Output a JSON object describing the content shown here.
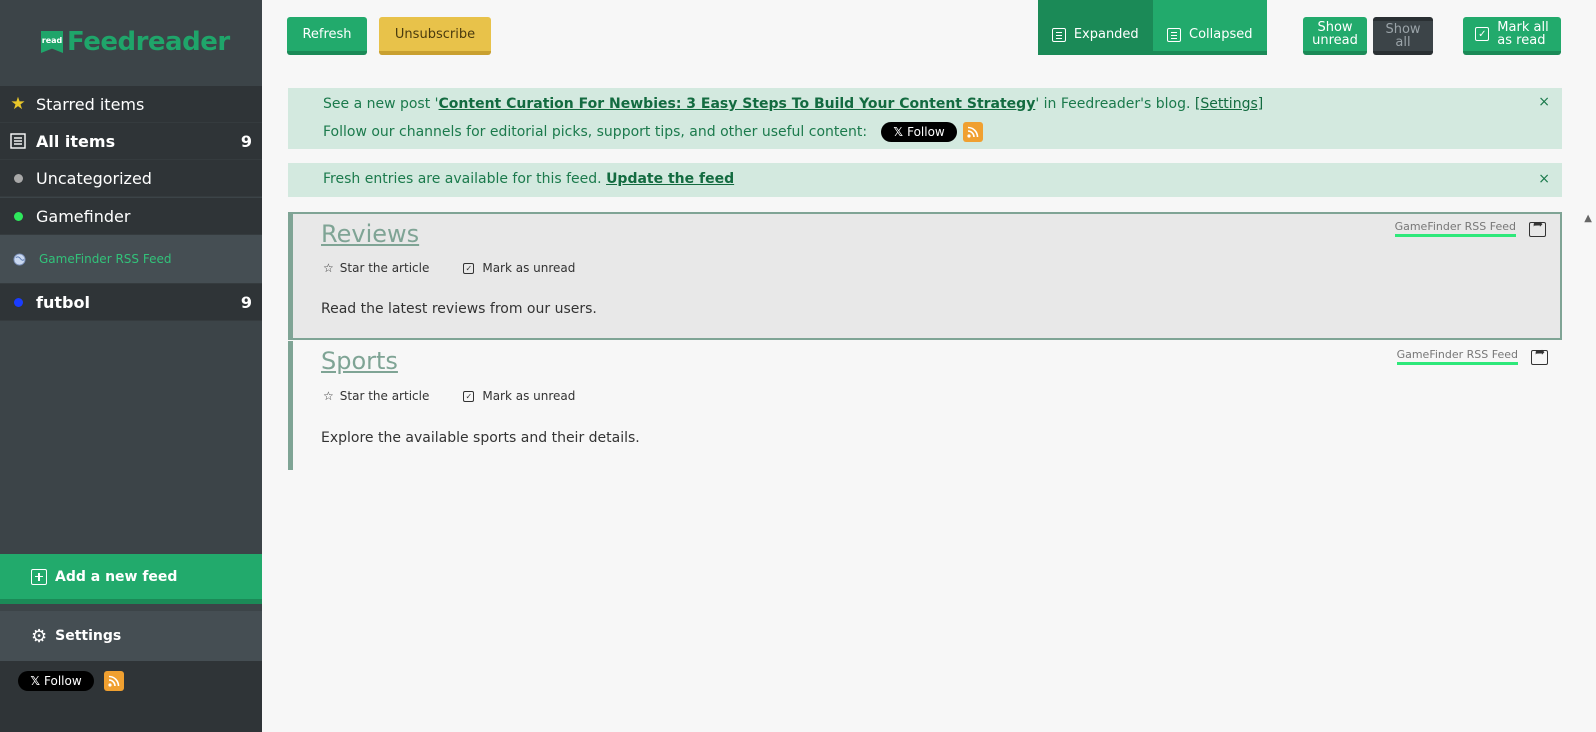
{
  "app": {
    "logo_badge": "read",
    "logo_text": "Feedreader"
  },
  "sidebar": {
    "items": [
      {
        "label": "Starred items",
        "icon": "star-icon",
        "color": "#e8c62a"
      },
      {
        "label": "All items",
        "count": "9",
        "icon": "list-icon"
      },
      {
        "label": "Uncategorized",
        "icon": "dot-icon",
        "color": "#a8a8a8"
      },
      {
        "label": "Gamefinder",
        "icon": "dot-icon",
        "color": "#2ee85c"
      },
      {
        "label": "GameFinder RSS Feed",
        "icon": "globe-icon"
      },
      {
        "label": "futbol",
        "count": "9",
        "icon": "dot-icon",
        "color": "#1a3cff"
      }
    ],
    "add_feed_label": "Add a new feed",
    "settings_label": "Settings",
    "follow_label": "Follow"
  },
  "toolbar": {
    "refresh_label": "Refresh",
    "unsubscribe_label": "Unsubscribe",
    "expanded_label": "Expanded",
    "collapsed_label": "Collapsed",
    "show_unread_line1": "Show",
    "show_unread_line2": "unread",
    "show_all_line1": "Show",
    "show_all_line2": "all",
    "mark_all_line1": "Mark all",
    "mark_all_line2": "as read"
  },
  "notices": {
    "blog": {
      "prefix": "See a new post '",
      "link": "Content Curation For Newbies: 3 Easy Steps To Build Your Content Strategy",
      "suffix": "' in Feedreader's blog. ",
      "settings_link": "[Settings]",
      "follow_text": "Follow our channels for editorial picks, support tips, and other useful content:",
      "follow_label": "Follow",
      "close": "×"
    },
    "fresh": {
      "text": "Fresh entries are available for this feed. ",
      "link": "Update the feed",
      "close": "×"
    }
  },
  "articles": [
    {
      "title": "Reviews",
      "star_label": "Star the article",
      "unread_label": "Mark as unread",
      "body": "Read the latest reviews from our users.",
      "feed": "GameFinder RSS Feed"
    },
    {
      "title": "Sports",
      "star_label": "Star the article",
      "unread_label": "Mark as unread",
      "body": "Explore the available sports and their details.",
      "feed": "GameFinder RSS Feed"
    }
  ],
  "colors": {
    "accent": "#22aa6c",
    "accent_dark": "#1b8a57",
    "sidebar_bg": "#3c4448",
    "notice_bg": "#d3e9df",
    "yellow": "#e8c24a"
  }
}
